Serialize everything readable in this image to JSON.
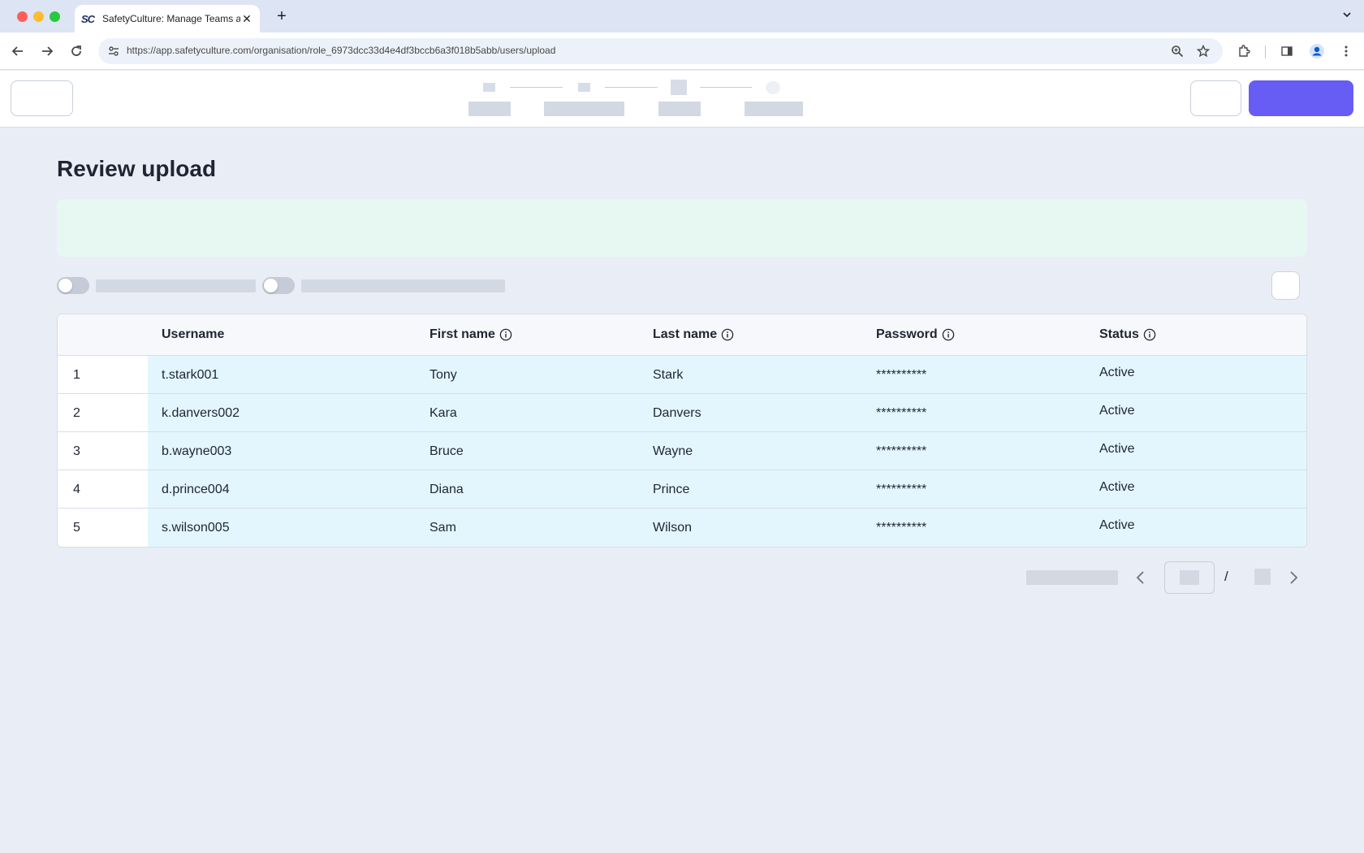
{
  "browser": {
    "tab_title": "SafetyCulture: Manage Teams and...",
    "tab_favicon": "SC",
    "tab_close_icon": "close-icon",
    "new_tab_glyph": "+",
    "url": "https://app.safetyculture.com/organisation/role_6973dcc33d4e4df3bccb6a3f018b5abb/users/upload"
  },
  "page": {
    "title": "Review upload"
  },
  "table": {
    "headers": {
      "username": "Username",
      "first_name": "First name",
      "last_name": "Last name",
      "password": "Password",
      "status": "Status"
    },
    "rows": [
      {
        "index": "1",
        "username": "t.stark001",
        "first_name": "Tony",
        "last_name": "Stark",
        "password": "**********",
        "status": "Active"
      },
      {
        "index": "2",
        "username": "k.danvers002",
        "first_name": "Kara",
        "last_name": "Danvers",
        "password": "**********",
        "status": "Active"
      },
      {
        "index": "3",
        "username": "b.wayne003",
        "first_name": "Bruce",
        "last_name": "Wayne",
        "password": "**********",
        "status": "Active"
      },
      {
        "index": "4",
        "username": "d.prince004",
        "first_name": "Diana",
        "last_name": "Prince",
        "password": "**********",
        "status": "Active"
      },
      {
        "index": "5",
        "username": "s.wilson005",
        "first_name": "Sam",
        "last_name": "Wilson",
        "password": "**********",
        "status": "Active"
      }
    ]
  },
  "pagination": {
    "separator": "/"
  },
  "colors": {
    "primary": "#675df4",
    "banner_bg": "#e6f8f1",
    "row_highlight": "#e3f6fd",
    "page_bg": "#e9edf5"
  }
}
